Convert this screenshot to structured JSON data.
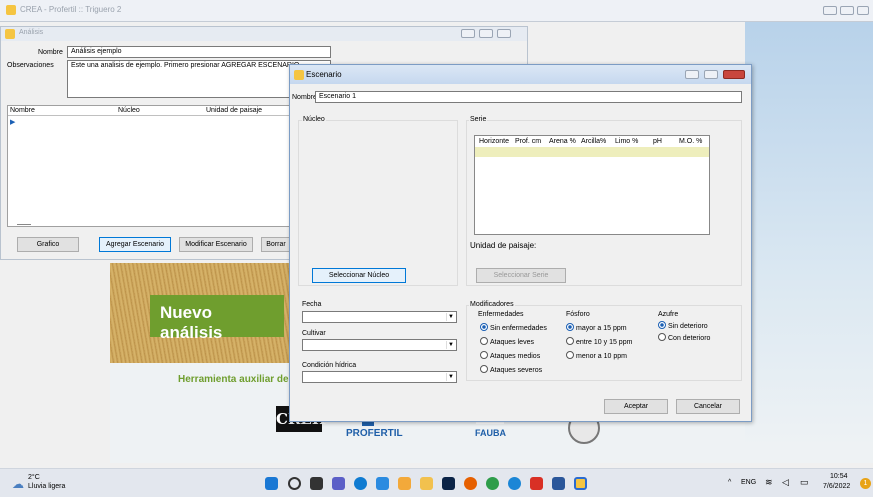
{
  "app": {
    "title": "CREA - Profertil :: Triguero 2"
  },
  "banner": {
    "nuevo": "Nuevo análisis",
    "herramienta": "Herramienta auxiliar del",
    "creh": "CREH",
    "profertil": "PROFERTIL",
    "fauba": "FAUBA"
  },
  "analisis": {
    "title": "Análisis",
    "nombre_label": "Nombre",
    "nombre_value": "Análisis ejemplo",
    "obs_label": "Observaciones",
    "obs_value": "Este una analisis de ejemplo. Primero presionar AGREGAR ESCENARIO",
    "columns": [
      "Nombre",
      "Núcleo",
      "Unidad de paisaje"
    ],
    "buttons": {
      "grafico": "Grafico",
      "agregar": "Agregar Escenario",
      "modificar": "Modificar Escenario",
      "borrar": "Borrar"
    }
  },
  "escenario": {
    "title": "Escenario",
    "nombre_label": "Nombre",
    "nombre_value": "Escenario 1",
    "nucleo_label": "Núcleo",
    "serie_label": "Serie",
    "serie_columns": [
      "Horizonte",
      "Prof. cm",
      "Arena %",
      "Arcilla%",
      "Limo %",
      "pH",
      "M.O. %"
    ],
    "unidad_label": "Unidad de paisaje:",
    "sel_nucleo": "Seleccionar Núcleo",
    "sel_serie": "Seleccionar Serie",
    "fecha_label": "Fecha",
    "cultivar_label": "Cultivar",
    "condicion_label": "Condición hídrica",
    "modificadores_label": "Modificadores",
    "enfermedades": {
      "label": "Enfermedades",
      "options": [
        "Sin enfermedades",
        "Ataques leves",
        "Ataques medios",
        "Ataques severos"
      ]
    },
    "fosforo": {
      "label": "Fósforo",
      "options": [
        "mayor a 15 ppm",
        "entre 10 y 15 ppm",
        "menor a 10 ppm"
      ]
    },
    "azufre": {
      "label": "Azufre",
      "options": [
        "Sin deterioro",
        "Con deterioro"
      ]
    },
    "aceptar": "Aceptar",
    "cancelar": "Cancelar"
  },
  "taskbar": {
    "temp": "2°C",
    "weather": "Lluvia ligera",
    "lang": "ENG",
    "time": "10:54",
    "date": "7/6/2022",
    "notif": "1"
  }
}
